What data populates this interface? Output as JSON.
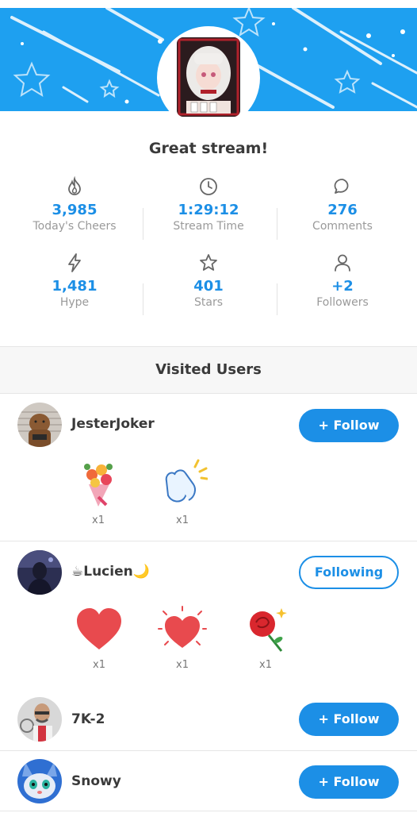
{
  "stream": {
    "title": "Great stream!"
  },
  "stats": [
    {
      "icon": "fire-icon",
      "value": "3,985",
      "label": "Today's Cheers"
    },
    {
      "icon": "clock-icon",
      "value": "1:29:12",
      "label": "Stream Time"
    },
    {
      "icon": "comment-icon",
      "value": "276",
      "label": "Comments"
    },
    {
      "icon": "lightning-icon",
      "value": "1,481",
      "label": "Hype"
    },
    {
      "icon": "star-icon",
      "value": "401",
      "label": "Stars"
    },
    {
      "icon": "person-icon",
      "value": "+2",
      "label": "Followers"
    }
  ],
  "visited": {
    "title": "Visited Users",
    "users": [
      {
        "name": "JesterJoker",
        "button": "+ Follow",
        "following": false,
        "gifts": [
          {
            "icon": "bouquet-icon",
            "qty": "x1"
          },
          {
            "icon": "clapping-hands-icon",
            "qty": "x1"
          }
        ]
      },
      {
        "name": "☕Lucien🌙",
        "button": "Following",
        "following": true,
        "gifts": [
          {
            "icon": "heart-icon",
            "qty": "x1"
          },
          {
            "icon": "sparkle-heart-icon",
            "qty": "x1"
          },
          {
            "icon": "rose-icon",
            "qty": "x1"
          }
        ]
      },
      {
        "name": "7K-2",
        "button": "+ Follow",
        "following": false,
        "gifts": []
      },
      {
        "name": "Snowy",
        "button": "+ Follow",
        "following": false,
        "gifts": []
      }
    ]
  },
  "colors": {
    "accent": "#1c8fe6",
    "banner": "#1ea0f0"
  }
}
